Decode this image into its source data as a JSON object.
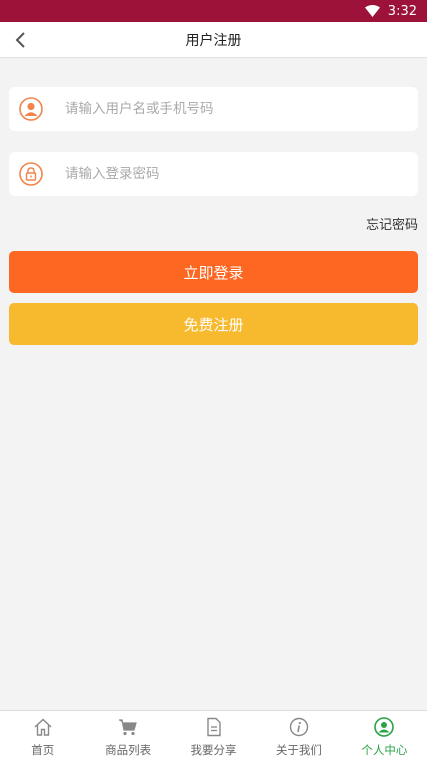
{
  "status_bar": {
    "time": "3:32"
  },
  "nav": {
    "title": "用户注册"
  },
  "form": {
    "username_placeholder": "请输入用户名或手机号码",
    "password_placeholder": "请输入登录密码",
    "forgot_label": "忘记密码"
  },
  "buttons": {
    "login_label": "立即登录",
    "register_label": "免费注册"
  },
  "tabbar": {
    "items": [
      {
        "label": "首页",
        "icon": "home-icon"
      },
      {
        "label": "商品列表",
        "icon": "cart-icon"
      },
      {
        "label": "我要分享",
        "icon": "document-icon"
      },
      {
        "label": "关于我们",
        "icon": "info-icon"
      },
      {
        "label": "个人中心",
        "icon": "user-circle-icon",
        "active": true
      }
    ]
  },
  "colors": {
    "status_bar": "#9c1238",
    "login_button": "#fd6722",
    "register_button": "#f7b92d",
    "input_icon": "#f2834a",
    "active_tab": "#2aa447"
  }
}
